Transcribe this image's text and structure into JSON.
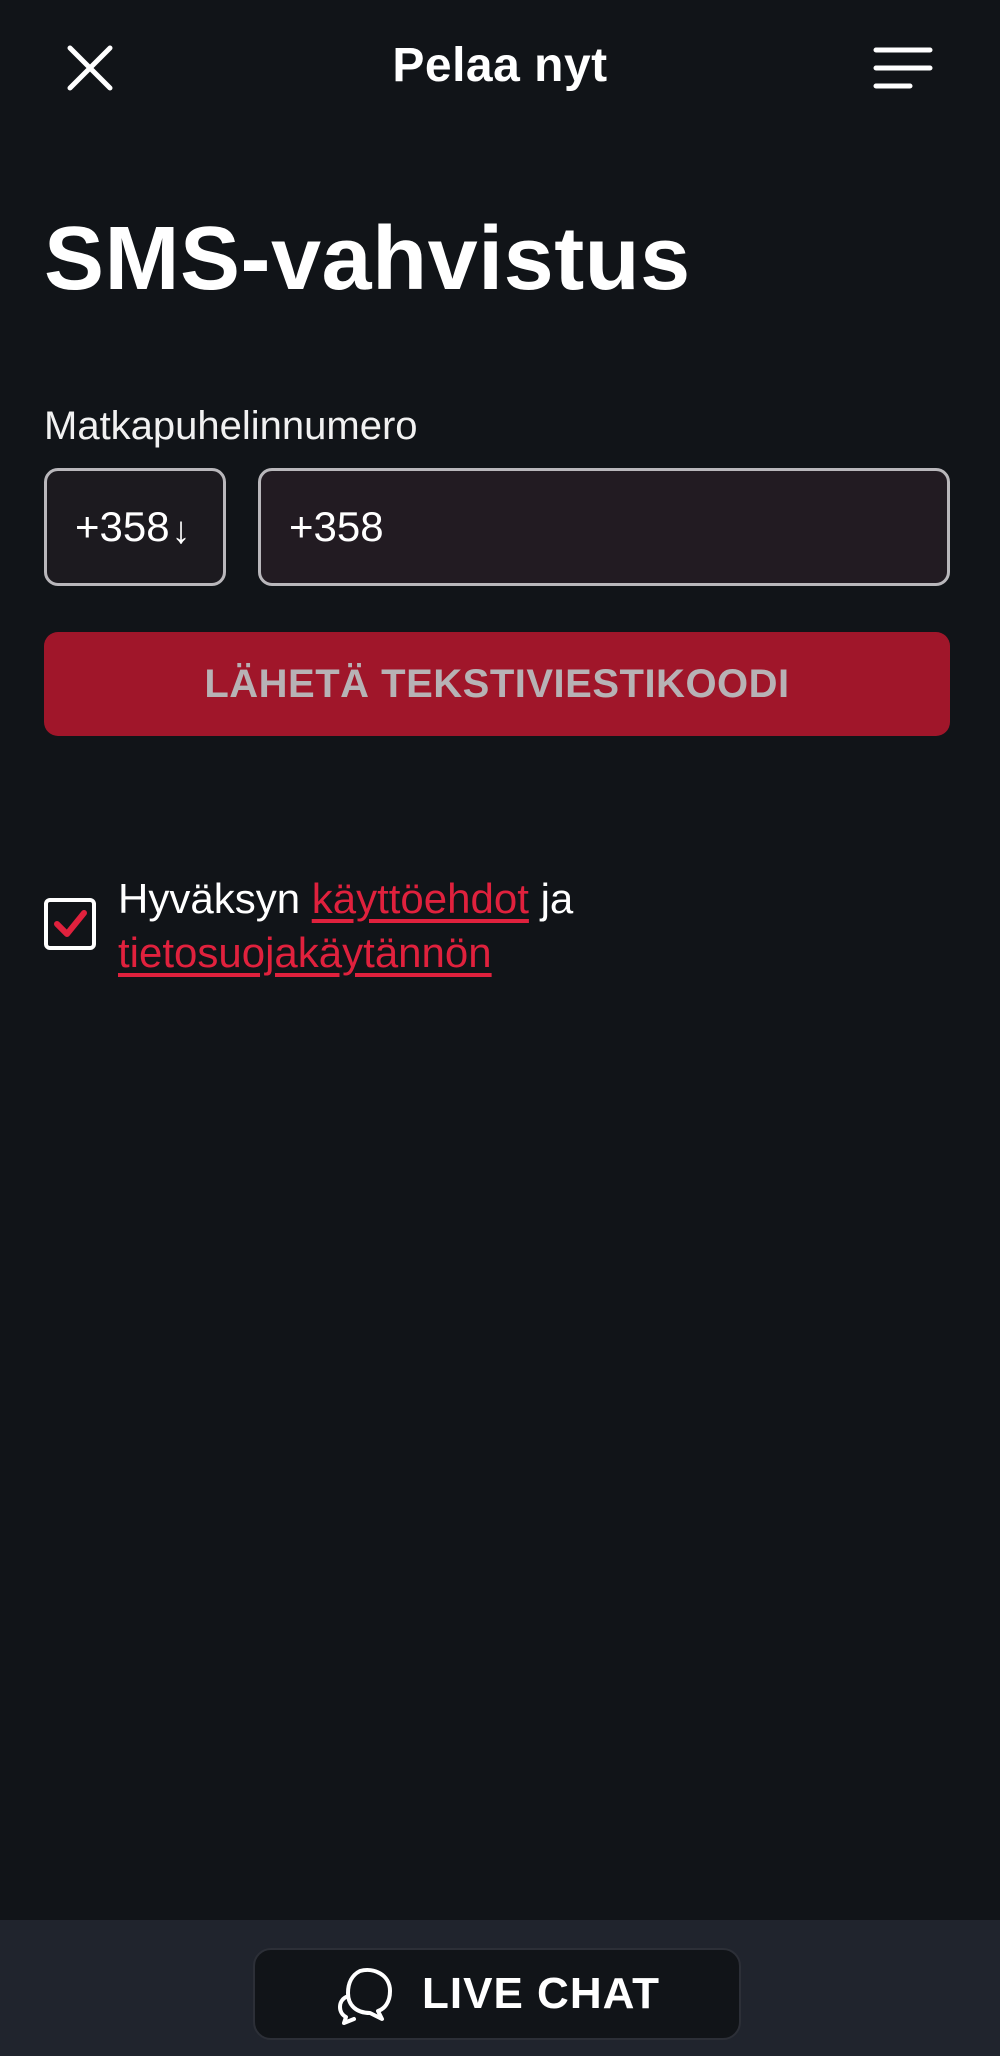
{
  "header": {
    "title": "Pelaa nyt",
    "close_icon": "close-icon",
    "menu_icon": "menu-icon"
  },
  "page": {
    "title": "SMS-vahvistus"
  },
  "phone": {
    "label": "Matkapuhelinnumero",
    "country_code": "+358",
    "country_arrow": "↓",
    "input_value": "+358"
  },
  "send_button": {
    "label": "LÄHETÄ TEKSTIVIESTIKOODI"
  },
  "consent": {
    "checked": true,
    "prefix": "Hyväksyn",
    "terms_link": "käyttöehdot",
    "conjunction": "ja",
    "privacy_link": "tietosuojakäytännön"
  },
  "footer": {
    "live_chat_label": "LIVE CHAT",
    "chat_icon": "chat-bubble-icon"
  },
  "colors": {
    "background": "#111418",
    "accent": "#e0213d",
    "button": "#a0162a",
    "footer": "#20242d"
  }
}
